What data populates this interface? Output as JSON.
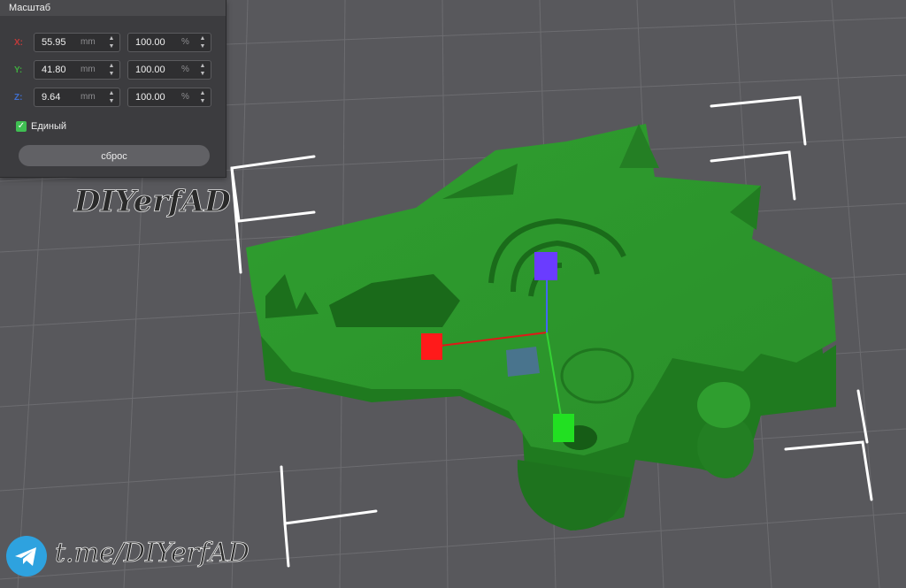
{
  "panel": {
    "title": "Масштаб",
    "rows": [
      {
        "axis": "X:",
        "size_value": "55.95",
        "size_unit": "mm",
        "percent_value": "100.00",
        "percent_unit": "%",
        "color": "#c03a3a"
      },
      {
        "axis": "Y:",
        "size_value": "41.80",
        "size_unit": "mm",
        "percent_value": "100.00",
        "percent_unit": "%",
        "color": "#3fae3f"
      },
      {
        "axis": "Z:",
        "size_value": "9.64",
        "size_unit": "mm",
        "percent_value": "100.00",
        "percent_unit": "%",
        "color": "#3f6fd0"
      }
    ],
    "uniform_label": "Единый",
    "uniform_checked": true,
    "reset_label": "сброс"
  },
  "watermark": {
    "top_text": "DIYerfAD",
    "bottom_text": "t.me/DIYerfAD"
  },
  "icons": {
    "telegram": "telegram-icon"
  },
  "colors": {
    "background": "#58585c",
    "model": "#2f9e2f",
    "handle_x": "#ff1a1a",
    "handle_y": "#22e022",
    "handle_z": "#6a3cff"
  }
}
